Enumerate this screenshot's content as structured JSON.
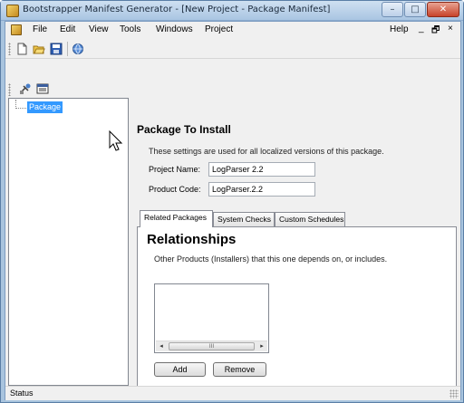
{
  "window": {
    "title": "Bootstrapper Manifest Generator - [New Project - Package Manifest]",
    "controls": {
      "minimize": "–",
      "maximize": "□",
      "close": "✕"
    }
  },
  "menubar": {
    "items": [
      "File",
      "Edit",
      "View",
      "Tools",
      "Windows",
      "Project"
    ],
    "help": "Help",
    "mdi_controls": {
      "minimize": "_",
      "restore": "🗗",
      "close": "×"
    }
  },
  "toolbar": {
    "buttons": [
      "new-file-icon",
      "open-folder-icon",
      "save-icon",
      "build-globe-icon"
    ]
  },
  "toolbar2": {
    "buttons": [
      "add-package-icon",
      "properties-icon"
    ]
  },
  "tree": {
    "nodes": [
      {
        "label": "Package",
        "selected": true
      }
    ]
  },
  "package": {
    "title": "Package To Install",
    "description": "These settings are used for all localized versions of this package.",
    "project_name_label": "Project Name:",
    "project_name_value": "LogParser 2.2",
    "product_code_label": "Product Code:",
    "product_code_value": "LogParser.2.2"
  },
  "tabs": [
    {
      "label": "Related Packages",
      "active": true
    },
    {
      "label": "System Checks",
      "active": false
    },
    {
      "label": "Custom Schedules",
      "active": false
    }
  ],
  "relationships": {
    "title": "Relationships",
    "description": "Other Products (Installers) that this one depends on, or includes.",
    "list_items": [],
    "scroll_thumb_glyph": "III",
    "add_label": "Add",
    "remove_label": "Remove"
  },
  "status": {
    "text": "Status"
  },
  "colors": {
    "selection": "#3399ff",
    "window_frame": "#a8c4de",
    "close_button": "#c8432a"
  }
}
